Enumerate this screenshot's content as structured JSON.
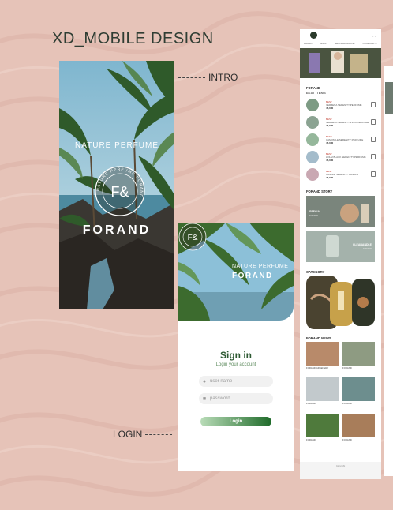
{
  "heading": "XD_MOBILE DESIGN",
  "callouts": {
    "intro": "INTRO",
    "login": "LOGIN"
  },
  "intro": {
    "tagline": "NATURE PERFUME",
    "seal_mark": "F&",
    "seal_ring": "NATURE PERFUME FORAND",
    "brand": "FORAND"
  },
  "login": {
    "tagline": "NATURE PERFUME",
    "brand": "FORAND",
    "seal_mark": "F&",
    "title": "Sign in",
    "subtitle": "Login your account",
    "username_placeholder": "user name",
    "password_placeholder": "password",
    "button": "Login"
  },
  "main_page": {
    "nav": [
      "BRAND",
      "SHOP",
      "NEWS/MAGAZINE",
      "COMMUNITY"
    ],
    "best_title": "FORAND",
    "best_subtitle": "BEST ITEMS",
    "best_items": [
      {
        "badge": "BEST",
        "name": "VERBENA SERENITY PERFUME",
        "price": "45,000",
        "color": "#7d9b84"
      },
      {
        "badge": "BEST",
        "name": "VERBENA SERENITY PLUS PERFUME",
        "price": "45,000",
        "color": "#8ba392"
      },
      {
        "badge": "BEST",
        "name": "CAMOMILE SERENITY PERFUME",
        "price": "45,000",
        "color": "#95b79b"
      },
      {
        "badge": "BEST",
        "name": "HOLM BLACK SERENITY PERFUME",
        "price": "45,000",
        "color": "#a4bccb"
      },
      {
        "badge": "BEST",
        "name": "CANDLE SERENITY CANDLE",
        "price": "45,000",
        "color": "#c9a8b2"
      }
    ],
    "story_title": "FORAND STORY",
    "story_cards": [
      {
        "label": "SPECIAL",
        "text": "FORAND"
      },
      {
        "label": "CLEANANDLE",
        "text": "FORAND"
      }
    ],
    "category_title": "CATEGORY",
    "news_title": "FORAND NEWS",
    "news": [
      {
        "caption": "FORAND GREENERY",
        "color": "#b88a6a"
      },
      {
        "caption": "FORAND",
        "color": "#8e9b82"
      },
      {
        "caption": "FORAND",
        "color": "#c2c9cc"
      },
      {
        "caption": "FORAND",
        "color": "#6d8e8e"
      },
      {
        "caption": "FORAND",
        "color": "#4f7a3c"
      },
      {
        "caption": "FORAND",
        "color": "#a87d5a"
      }
    ],
    "footer": "Copyright"
  },
  "colors": {
    "background": "#e6c3b8",
    "brand_green": "#2e5a33",
    "button_start": "#b9dcb8",
    "button_end": "#1f6b2a"
  }
}
